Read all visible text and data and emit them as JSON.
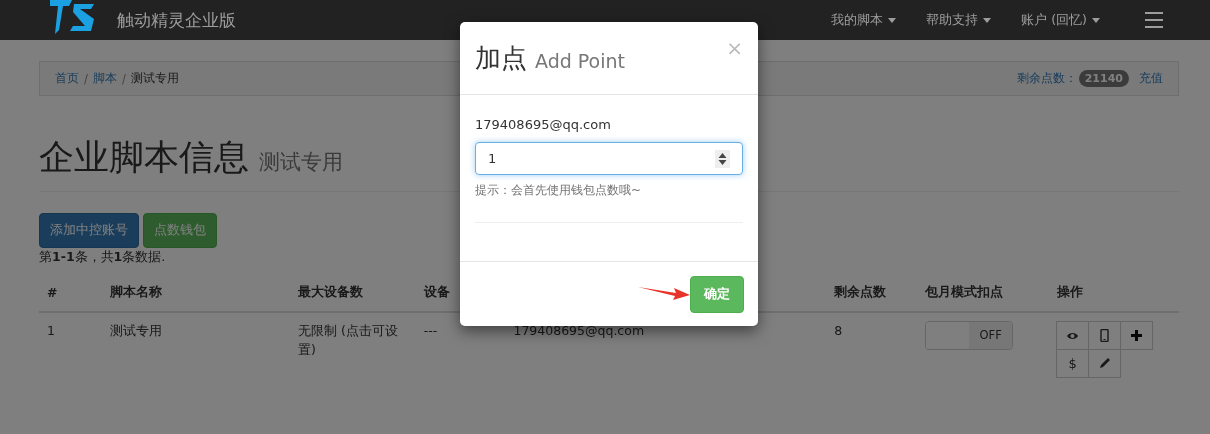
{
  "navbar": {
    "brand": "触动精灵企业版",
    "menus": [
      {
        "label": "我的脚本"
      },
      {
        "label": "帮助支持"
      },
      {
        "label": "账户 (回忆)"
      }
    ]
  },
  "breadcrumb": {
    "items": [
      {
        "label": "首页",
        "kind": "link"
      },
      {
        "label": "脚本",
        "kind": "link"
      },
      {
        "label": "测试专用",
        "kind": "current"
      }
    ],
    "separator": "/",
    "balance_label": "剩余点数：",
    "balance": "21140",
    "recharge": "充值"
  },
  "page_header": {
    "title": "企业脚本信息",
    "subtitle": "测试专用"
  },
  "buttons": [
    {
      "label": "添加中控账号",
      "kind": "primary"
    },
    {
      "label": "点数钱包",
      "kind": "success"
    }
  ],
  "summary": "第**1-1**条，共**1**条数据.",
  "table": {
    "columns": [
      "#",
      "脚本名称",
      "最大设备数",
      "设备",
      "",
      "剩余点数",
      "包月模式扣点",
      "操作"
    ],
    "rows": [
      {
        "cells": [
          "1",
          "测试专用",
          "无限制 (点击可设置)",
          "---",
          "179408695@qq.com",
          "8"
        ],
        "monthly_toggle": {
          "on": false,
          "label": "OFF"
        },
        "actions": [
          {
            "kind": "eye"
          },
          {
            "kind": "phone"
          },
          {
            "kind": "plus"
          },
          {
            "kind": "text",
            "label": "$"
          },
          {
            "kind": "pencil"
          }
        ]
      }
    ]
  },
  "modal": {
    "title": "加点",
    "subtitle": "Add Point",
    "close": "×",
    "email": "179408695@qq.com",
    "value": "1",
    "hint": "提示：会首先使用钱包点数哦~",
    "confirm": "确定"
  }
}
